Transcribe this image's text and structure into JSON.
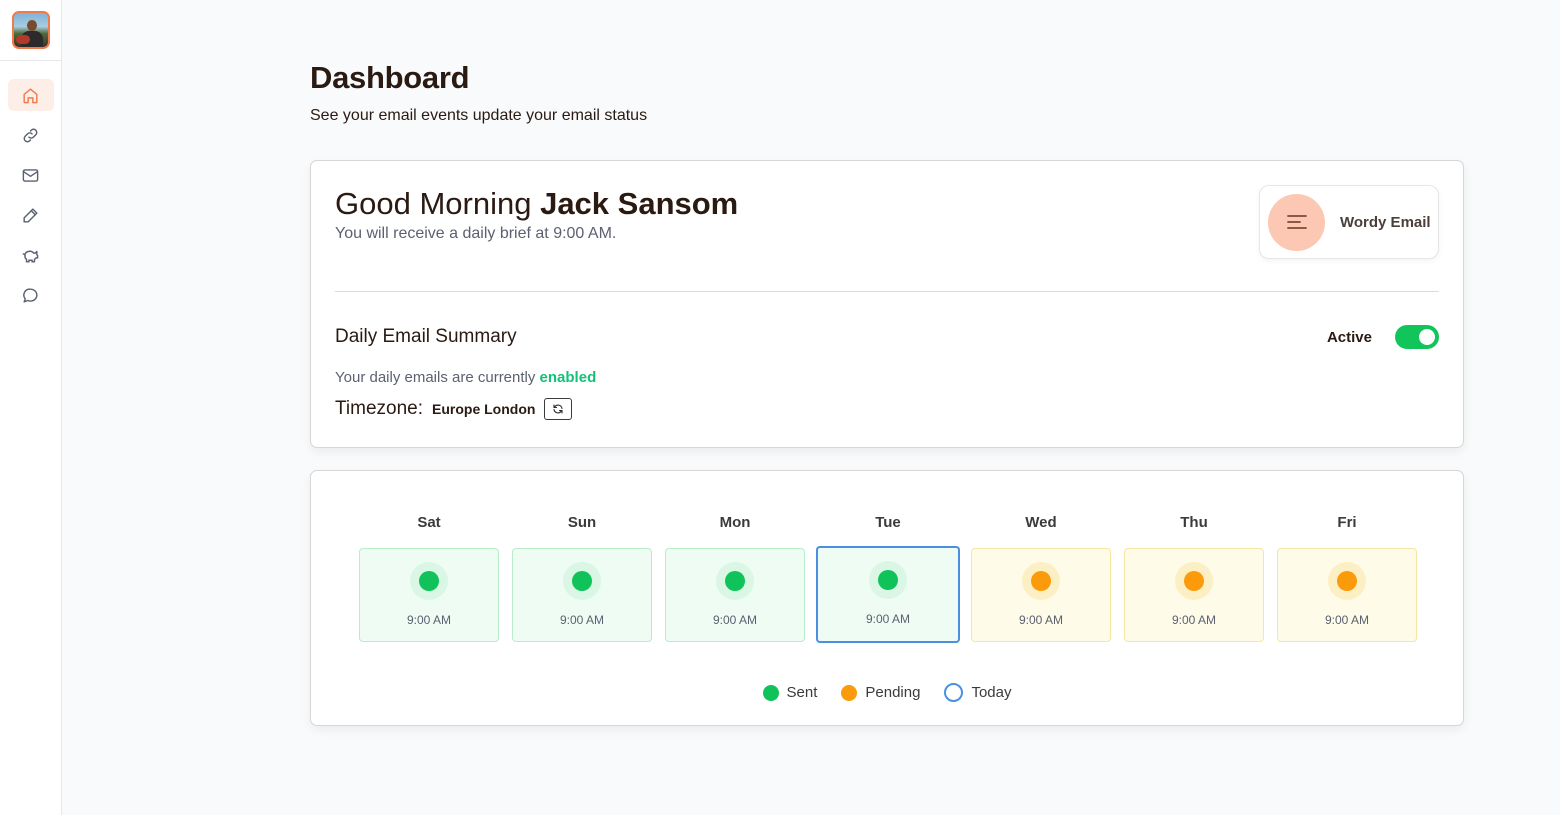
{
  "sidebar": {
    "avatar_alt": "user avatar",
    "items": [
      {
        "name": "home",
        "icon": "home-icon",
        "active": true
      },
      {
        "name": "links",
        "icon": "link-icon",
        "active": false
      },
      {
        "name": "mail",
        "icon": "mail-icon",
        "active": false
      },
      {
        "name": "edit",
        "icon": "pencil-icon",
        "active": false
      },
      {
        "name": "savings",
        "icon": "piggy-bank-icon",
        "active": false
      },
      {
        "name": "messages",
        "icon": "chat-bubble-icon",
        "active": false
      }
    ]
  },
  "header": {
    "title": "Dashboard",
    "subtitle": "See your email events update your email status"
  },
  "greeting": {
    "prefix": "Good Morning",
    "name": "Jack Sansom",
    "brief": "You will receive a daily brief at 9:00 AM."
  },
  "wordy": {
    "label": "Wordy Email",
    "icon": "menu-lines-icon"
  },
  "summary": {
    "title": "Daily Email Summary",
    "active_label": "Active",
    "toggle_on": true,
    "status_prefix": "Your daily emails are currently",
    "status_value": "enabled",
    "timezone_label": "Timezone:",
    "timezone_value": "Europe London",
    "refresh_icon": "refresh-icon"
  },
  "week": {
    "days": [
      {
        "name": "Sat",
        "time": "9:00 AM",
        "status": "sent",
        "today": false
      },
      {
        "name": "Sun",
        "time": "9:00 AM",
        "status": "sent",
        "today": false
      },
      {
        "name": "Mon",
        "time": "9:00 AM",
        "status": "sent",
        "today": false
      },
      {
        "name": "Tue",
        "time": "9:00 AM",
        "status": "sent",
        "today": true
      },
      {
        "name": "Wed",
        "time": "9:00 AM",
        "status": "pending",
        "today": false
      },
      {
        "name": "Thu",
        "time": "9:00 AM",
        "status": "pending",
        "today": false
      },
      {
        "name": "Fri",
        "time": "9:00 AM",
        "status": "pending",
        "today": false
      }
    ],
    "legend": {
      "sent": "Sent",
      "pending": "Pending",
      "today": "Today"
    }
  },
  "colors": {
    "accent": "#f07a4a",
    "sent": "#10c25a",
    "pending": "#fb9b0b",
    "today": "#4a90e2",
    "enabled_text": "#12c27a"
  }
}
